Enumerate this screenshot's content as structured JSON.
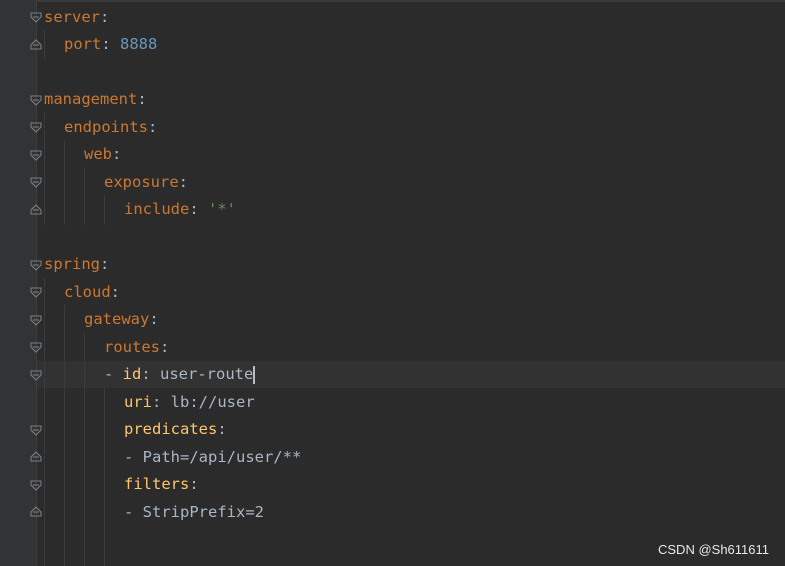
{
  "lines": [
    {
      "key": "server",
      "punct": ":"
    },
    {
      "key": "port",
      "punct": ": ",
      "value": "8888"
    },
    {
      "key": "management",
      "punct": ":"
    },
    {
      "key": "endpoints",
      "punct": ":"
    },
    {
      "key": "web",
      "punct": ":"
    },
    {
      "key": "exposure",
      "punct": ":"
    },
    {
      "key": "include",
      "punct": ": ",
      "value": "'*'"
    },
    {
      "key": "spring",
      "punct": ":"
    },
    {
      "key": "cloud",
      "punct": ":"
    },
    {
      "key": "gateway",
      "punct": ":"
    },
    {
      "key": "routes",
      "punct": ":"
    },
    {
      "dash": "- ",
      "key": "id",
      "punct": ": ",
      "value": "user-route"
    },
    {
      "key": "uri",
      "punct": ": ",
      "value": "lb://user"
    },
    {
      "key": "predicates",
      "punct": ":"
    },
    {
      "value": "- Path=/api/user/**"
    },
    {
      "key": "filters",
      "punct": ":"
    },
    {
      "value": "- StripPrefix=2"
    }
  ],
  "watermark": "CSDN @Sh611611",
  "colors": {
    "background": "#2b2b2b",
    "key": "#cc7832",
    "key_nested": "#ffc66d",
    "number": "#6897bb",
    "string": "#6a8759",
    "text": "#a9b7c6"
  },
  "icons": {
    "fold_start": "fold-start-icon",
    "fold_end": "fold-end-icon"
  }
}
